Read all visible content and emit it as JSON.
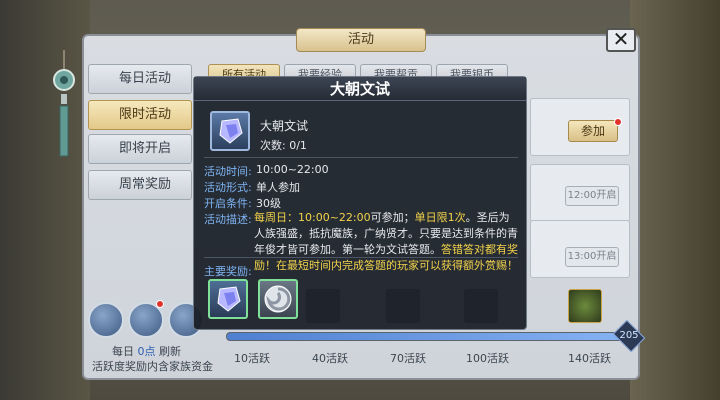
{
  "window": {
    "title": "活动",
    "close_glyph": "✕"
  },
  "nav": {
    "items": [
      {
        "label": "每日活动"
      },
      {
        "label": "限时活动"
      },
      {
        "label": "即将开启"
      },
      {
        "label": "周常奖励"
      }
    ]
  },
  "tabs": [
    {
      "label": "所有活动"
    },
    {
      "label": "我要经验"
    },
    {
      "label": "我要帮贡"
    },
    {
      "label": "我要银币"
    }
  ],
  "list": {
    "join_label": "参加",
    "open_times": [
      "12:00开启",
      "13:00开启"
    ]
  },
  "bottom": {
    "refresh_prefix": "每日",
    "refresh_time": "0点",
    "refresh_suffix": "刷新",
    "note": "活跃度奖励内含家族资金",
    "points": "205",
    "progress": 1.0,
    "milestones": [
      "10活跃",
      "40活跃",
      "70活跃",
      "100活跃",
      "140活跃"
    ]
  },
  "popup": {
    "title": "大朝文试",
    "name": "大朝文试",
    "count": "次数: 0/1",
    "time_label": "活动时间:",
    "time_value": "10:00~22:00",
    "form_label": "活动形式:",
    "form_value": "单人参加",
    "cond_label": "开启条件:",
    "cond_value": "30级",
    "desc_label": "活动描述:",
    "desc_parts": {
      "p1": "每周日：10:00~22:00",
      "p2": "可参加；",
      "p3": "单日限1次",
      "p4": "。圣后为人族强盛，抵抗魔族，广纳贤才。只要是达到条件的青年俊才皆可参加。第一轮为文试答题。",
      "p5": "答错答对都有奖励！在最短时间内完成答题的玩家可以获得额外赏赐！"
    },
    "reward_label": "主要奖励:"
  },
  "colors": {
    "accent_gold": "#dcc58d",
    "popup_bg": "#191e26",
    "label_blue": "#7fb4f5",
    "highlight_yellow": "#f2d34b"
  }
}
